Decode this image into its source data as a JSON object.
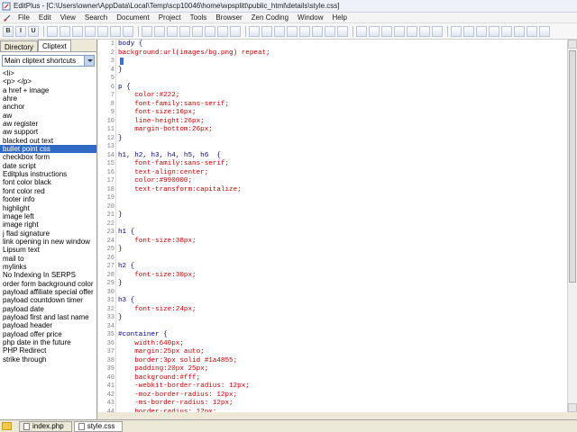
{
  "window": {
    "title": "EditPlus - [C:\\Users\\owner\\AppData\\Local\\Temp\\scp10046\\home\\wpsplitt\\public_html\\details\\style.css]"
  },
  "menu": [
    "File",
    "Edit",
    "View",
    "Search",
    "Document",
    "Project",
    "Tools",
    "Browser",
    "Zen Coding",
    "Window",
    "Help"
  ],
  "toolbar": {
    "buttons": [
      "B",
      "I",
      "U",
      "",
      "",
      "",
      "",
      "",
      "",
      "",
      "",
      "",
      "",
      "",
      "",
      "",
      "",
      "",
      "",
      "",
      "",
      "",
      "",
      "",
      "",
      "",
      "",
      "",
      "",
      "",
      "",
      "",
      "",
      "",
      "",
      "",
      "",
      "",
      "",
      "",
      ""
    ]
  },
  "left_panel": {
    "tabs": [
      "Directory",
      "Cliptext"
    ],
    "active_tab": "Cliptext",
    "library": "Main cliptext shortcuts",
    "items": [
      "<li>",
      "<p> </p>",
      "a href + image",
      "ahre",
      "anchor",
      "aw",
      "aw register",
      "aw support",
      "blacked out text",
      "bullet point css",
      "checkbox form",
      "date script",
      "Editplus instructions",
      "font color black",
      "font color red",
      "footer info",
      "highlight",
      "image left",
      "image right",
      "j flad signature",
      "link opening in new window",
      "Lipsum text",
      "mail to",
      "mylinks",
      "No Indexing In SERPS",
      "order form background color",
      "payload affiliate special offer",
      "payload countdown timer",
      "payload date",
      "payload first and last name",
      "payload header",
      "payload offer price",
      "php date in the future",
      "PHP Redirect",
      "strike through"
    ],
    "selected_index": 9
  },
  "editor": {
    "lines": [
      {
        "n": "1",
        "t": "body {"
      },
      {
        "n": "2",
        "t": "background:url(images/bg.png) repeat;"
      },
      {
        "n": "3",
        "t": ""
      },
      {
        "n": "4",
        "t": "}"
      },
      {
        "n": "5",
        "t": ""
      },
      {
        "n": "6",
        "t": "p {"
      },
      {
        "n": "7",
        "t": "    color:#222;"
      },
      {
        "n": "8",
        "t": "    font-family:sans-serif;"
      },
      {
        "n": "9",
        "t": "    font-size:16px;"
      },
      {
        "n": "10",
        "t": "    line-height:26px;"
      },
      {
        "n": "11",
        "t": "    margin-bottom:26px;"
      },
      {
        "n": "12",
        "t": "}"
      },
      {
        "n": "13",
        "t": ""
      },
      {
        "n": "14",
        "t": "h1, h2, h3, h4, h5, h6  {"
      },
      {
        "n": "15",
        "t": "    font-family:sans-serif;"
      },
      {
        "n": "16",
        "t": "    text-align:center;"
      },
      {
        "n": "17",
        "t": "    color:#990000;"
      },
      {
        "n": "18",
        "t": "    text-transform:capitalize;"
      },
      {
        "n": "19",
        "t": ""
      },
      {
        "n": "20",
        "t": ""
      },
      {
        "n": "21",
        "t": "}"
      },
      {
        "n": "22",
        "t": ""
      },
      {
        "n": "23",
        "t": "h1 {"
      },
      {
        "n": "24",
        "t": "    font-size:38px;"
      },
      {
        "n": "25",
        "t": "}"
      },
      {
        "n": "26",
        "t": ""
      },
      {
        "n": "27",
        "t": "h2 {"
      },
      {
        "n": "28",
        "t": "    font-size:30px;"
      },
      {
        "n": "29",
        "t": "}"
      },
      {
        "n": "30",
        "t": ""
      },
      {
        "n": "31",
        "t": "h3 {"
      },
      {
        "n": "32",
        "t": "    font-size:24px;"
      },
      {
        "n": "33",
        "t": "}"
      },
      {
        "n": "34",
        "t": ""
      },
      {
        "n": "35",
        "t": "#container {"
      },
      {
        "n": "36",
        "t": "    width:640px;"
      },
      {
        "n": "37",
        "t": "    margin:25px auto;"
      },
      {
        "n": "38",
        "t": "    border:3px solid #1a4855;"
      },
      {
        "n": "39",
        "t": "    padding:20px 25px;"
      },
      {
        "n": "40",
        "t": "    background:#fff;"
      },
      {
        "n": "41",
        "t": "    -webkit-border-radius: 12px;"
      },
      {
        "n": "42",
        "t": "    -moz-border-radius: 12px;"
      },
      {
        "n": "43",
        "t": "    -ms-border-radius: 12px;"
      },
      {
        "n": "44",
        "t": "    border-radius: 12px;"
      }
    ]
  },
  "doc_tabs": [
    "index.php",
    "style.css"
  ],
  "active_doc": "style.css",
  "colors": {
    "code_keyword": "#000080",
    "code_value": "#c00000",
    "selection": "#316ac5"
  }
}
